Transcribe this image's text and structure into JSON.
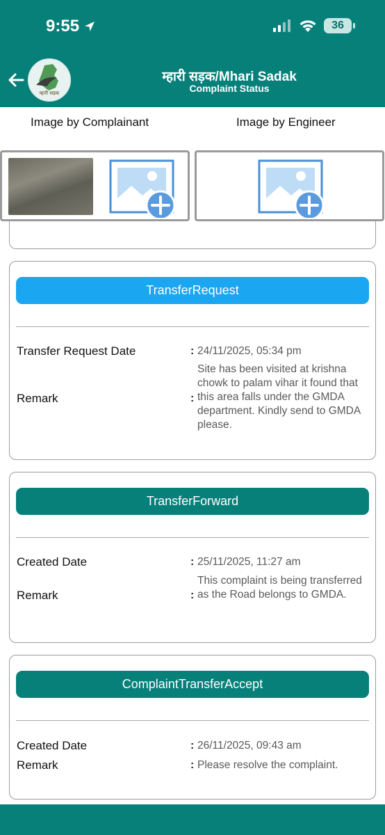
{
  "status_bar": {
    "time": "9:55",
    "battery": "36"
  },
  "header": {
    "title": "म्हारी सड़क/Mhari Sadak",
    "subtitle": "Complaint Status",
    "logo_text": "म्हारी सड़क"
  },
  "images": {
    "complainant_label": "Image by Complainant",
    "engineer_label": "Image by Engineer"
  },
  "cards": [
    {
      "status": "TransferRequest",
      "status_color": "#1aa6f0",
      "rows": [
        {
          "label": "Transfer Request Date",
          "value": "24/11/2025, 05:34 pm"
        },
        {
          "label": "Remark",
          "value": "Site has been visited at krishna chowk to palam vihar it found that  this area falls under the GMDA department. Kindly send to GMDA please."
        }
      ]
    },
    {
      "status": "TransferForward",
      "status_color": "#08807a",
      "rows": [
        {
          "label": "Created Date",
          "value": "25/11/2025, 11:27 am"
        },
        {
          "label": "Remark",
          "value": "This complaint is being transferred as the Road belongs to GMDA."
        }
      ]
    },
    {
      "status": "ComplaintTransferAccept",
      "status_color": "#08807a",
      "rows": [
        {
          "label": "Created Date",
          "value": "26/11/2025, 09:43 am"
        },
        {
          "label": "Remark",
          "value": "Please resolve the complaint."
        }
      ]
    }
  ],
  "colon": ":",
  "colors": {
    "brand": "#08807a",
    "accent_blue": "#1aa6f0",
    "placeholder_blue": "#4a8fd8"
  }
}
